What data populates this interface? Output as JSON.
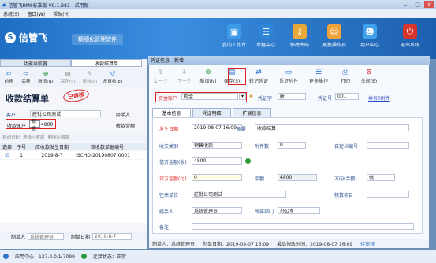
{
  "window": {
    "title": "信管飞RMS标准版 V9.1.383 - 试用版"
  },
  "menu": [
    "系统(S)",
    "窗口(W)",
    "帮助(H)"
  ],
  "brand": {
    "logo": "信管飞",
    "slogan": "精细化管理软件"
  },
  "top_tools": [
    "我的工作台",
    "单据中心",
    "修改密码",
    "更换操作员",
    "用户中心",
    "退出系统"
  ],
  "left": {
    "tabs": [
      "功能导航器",
      "收款结算单"
    ],
    "tools": [
      "前移",
      "后移",
      "新增(N)",
      "保存(S)",
      "审核(A)",
      "反审核(E)"
    ],
    "title": "收款结算单",
    "stamp": "已审核",
    "customer_label": "客户",
    "customer_value": "莊批公司测试",
    "handler_label": "经手人",
    "account_label": "收款账户",
    "account_value": "现金",
    "account_amount": "4800",
    "amount_label": "收款金额",
    "sub_tools": [
      "自动分配",
      "选择应收款",
      "删除应收款"
    ],
    "grid_headers": [
      "选择",
      "序号",
      "应收款发生日期",
      "应收款单据编号"
    ],
    "grid_row": {
      "no": "1",
      "date": "2019-8-7",
      "code": "ISCHD-20190807-0001"
    },
    "footer_maker_label": "制单人",
    "footer_maker": "系统管理员",
    "footer_date_label": "制单日期",
    "footer_date": "2019-8-7"
  },
  "dialog": {
    "title": "凭证信息 - 新增",
    "tools": [
      "上一个",
      "下一个",
      "新增(N)",
      "保存(S)",
      "转记凭证",
      "凭证附件",
      "更多操作",
      "打印",
      "关闭(E)"
    ],
    "account_label": "资金账户",
    "account_value": "现金",
    "voucher_word_label": "凭证字",
    "voucher_word": "收",
    "voucher_no_label": "凭证号",
    "voucher_no": "001",
    "link_label": "共有0附件",
    "tabs": [
      "基本信息",
      "凭证明细",
      "扩展信息"
    ],
    "fields": {
      "date_label": "发生日期",
      "date": "2019-08-07 16:09",
      "summary_label": "摘要",
      "summary": "收款结算",
      "category_label": "收支类别",
      "category": "销售收款",
      "attach_label": "附件数",
      "attach": "0",
      "custom_no_label": "自定义编号",
      "borrow_label": "借方金额(收)",
      "borrow": "4800",
      "lend_label": "贷方金额(付)",
      "lend": "0",
      "balance_label": "余额",
      "balance": "4800",
      "direction_label": "方向(余额)",
      "direction": "借",
      "unit_label": "往来单位",
      "unit": "莊批公司测试",
      "project_label": "核算项目",
      "handler_label": "经手人",
      "handler": "系统管理员",
      "dept_label": "所属部门",
      "dept": "办公室",
      "remark_label": "备注"
    },
    "footer": {
      "maker": "制单人：系统管理员",
      "date": "制单日期：2019-08-07 16:09",
      "modified": "最后修改时间：2019-08-07 16:09",
      "status": "待审核"
    }
  },
  "status": {
    "server": "应用中心：127.0.0.1:7099",
    "conn": "连接状态：正常"
  },
  "colors": {
    "accent": "#2a74c9",
    "highlight": "#e02020"
  }
}
